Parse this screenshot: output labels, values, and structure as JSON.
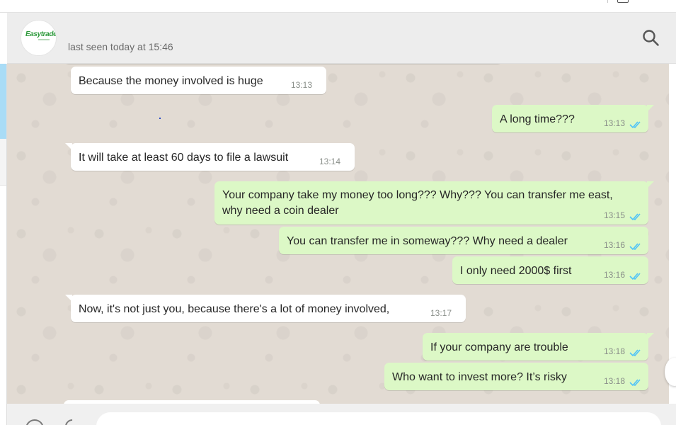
{
  "header": {
    "contact_logo_text": "Easytrade",
    "status": "last seen today at 15:46",
    "search_icon": "search-icon"
  },
  "messages": [
    {
      "direction": "in",
      "text": "Because the money involved is huge",
      "time": "13:13"
    },
    {
      "direction": "out",
      "text": "A long time???",
      "time": "13:13",
      "read": true
    },
    {
      "direction": "in",
      "text": "It will take at least 60 days to file a lawsuit",
      "time": "13:14"
    },
    {
      "direction": "out",
      "text_line1": "Your company take my money too long??? Why??? You can transfer me east,",
      "text_line2": "why need a coin dealer",
      "time": "13:15",
      "read": true
    },
    {
      "direction": "out",
      "text": "You can transfer me in someway??? Why need a dealer",
      "time": "13:16",
      "read": true
    },
    {
      "direction": "out",
      "text": "I only need 2000$ first",
      "time": "13:16",
      "read": true
    },
    {
      "direction": "in",
      "text": "Now, it's not just you, because there's a lot of money involved,",
      "time": "13:17"
    },
    {
      "direction": "out",
      "text": "If your company are trouble",
      "time": "13:18",
      "read": true
    },
    {
      "direction": "out",
      "text": "Who want to invest more? It’s risky",
      "time": "13:18",
      "read": true
    }
  ],
  "colors": {
    "incoming_bubble": "#ffffff",
    "outgoing_bubble": "#dcf8c6",
    "chat_background": "#e2dbd3",
    "read_ticks": "#4fc3f7",
    "header_background": "#ededed"
  }
}
